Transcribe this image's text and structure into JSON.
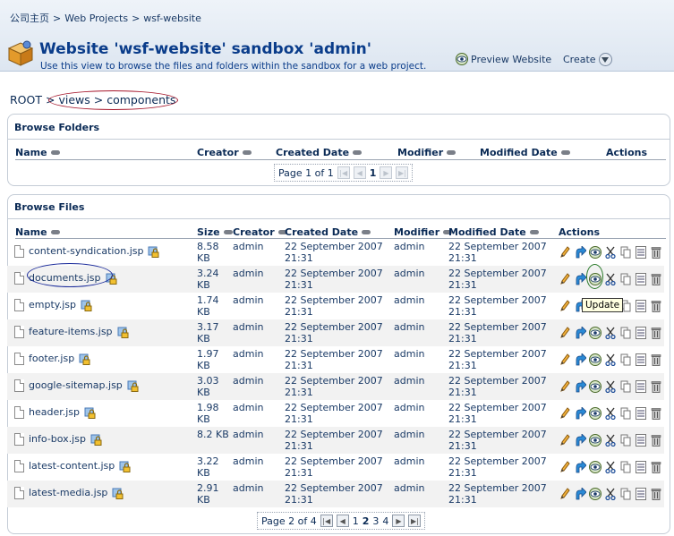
{
  "breadcrumbs": [
    "公司主页",
    "Web Projects",
    "wsf-website"
  ],
  "header": {
    "title": "Website 'wsf-website' sandbox 'admin'",
    "subtitle": "Use this view to browse the files and folders within the sandbox for a web project.",
    "preview_label": "Preview Website",
    "create_label": "Create"
  },
  "path": {
    "root": "ROOT",
    "sep": ">",
    "views": "views",
    "components": "components"
  },
  "folders": {
    "title": "Browse Folders",
    "columns": [
      "Name",
      "Creator",
      "Created Date",
      "Modifier",
      "Modified Date",
      "Actions"
    ],
    "pager": {
      "text": "Page 1 of 1",
      "current": "1"
    }
  },
  "files": {
    "title": "Browse Files",
    "columns": [
      "Name",
      "Size",
      "Creator",
      "Created Date",
      "Modifier",
      "Modified Date",
      "Actions"
    ],
    "rows": [
      {
        "name": "content-syndication.jsp",
        "size1": "8.58",
        "size2": "KB",
        "creator": "admin",
        "created1": "22 September 2007",
        "created2": "21:31",
        "modifier": "admin",
        "modified1": "22 September 2007",
        "modified2": "21:31"
      },
      {
        "name": "documents.jsp",
        "size1": "3.24",
        "size2": "KB",
        "creator": "admin",
        "created1": "22 September 2007",
        "created2": "21:31",
        "modifier": "admin",
        "modified1": "22 September 2007",
        "modified2": "21:31"
      },
      {
        "name": "empty.jsp",
        "size1": "1.74",
        "size2": "KB",
        "creator": "admin",
        "created1": "22 September 2007",
        "created2": "21:31",
        "modifier": "admin",
        "modified1": "22 September 2007",
        "modified2": "21:31"
      },
      {
        "name": "feature-items.jsp",
        "size1": "3.17",
        "size2": "KB",
        "creator": "admin",
        "created1": "22 September 2007",
        "created2": "21:31",
        "modifier": "admin",
        "modified1": "22 September 2007",
        "modified2": "21:31"
      },
      {
        "name": "footer.jsp",
        "size1": "1.97",
        "size2": "KB",
        "creator": "admin",
        "created1": "22 September 2007",
        "created2": "21:31",
        "modifier": "admin",
        "modified1": "22 September 2007",
        "modified2": "21:31"
      },
      {
        "name": "google-sitemap.jsp",
        "size1": "3.03",
        "size2": "KB",
        "creator": "admin",
        "created1": "22 September 2007",
        "created2": "21:31",
        "modifier": "admin",
        "modified1": "22 September 2007",
        "modified2": "21:31"
      },
      {
        "name": "header.jsp",
        "size1": "1.98",
        "size2": "KB",
        "creator": "admin",
        "created1": "22 September 2007",
        "created2": "21:31",
        "modifier": "admin",
        "modified1": "22 September 2007",
        "modified2": "21:31"
      },
      {
        "name": "info-box.jsp",
        "size1": "8.2 KB",
        "size2": "",
        "creator": "admin",
        "created1": "22 September 2007",
        "created2": "21:31",
        "modifier": "admin",
        "modified1": "22 September 2007",
        "modified2": "21:31"
      },
      {
        "name": "latest-content.jsp",
        "size1": "3.22",
        "size2": "KB",
        "creator": "admin",
        "created1": "22 September 2007",
        "created2": "21:31",
        "modifier": "admin",
        "modified1": "22 September 2007",
        "modified2": "21:31"
      },
      {
        "name": "latest-media.jsp",
        "size1": "2.91",
        "size2": "KB",
        "creator": "admin",
        "created1": "22 September 2007",
        "created2": "21:31",
        "modifier": "admin",
        "modified1": "22 September 2007",
        "modified2": "21:31"
      }
    ],
    "pager": {
      "text": "Page 2 of 4",
      "pages": [
        "1",
        "2",
        "3",
        "4"
      ],
      "current": "2"
    }
  },
  "tooltip": "Update",
  "icons": {
    "header": "sandbox-box-icon",
    "row_actions": [
      "edit-pencil-icon",
      "update-arrow-icon",
      "preview-eye-icon",
      "cut-scissors-icon",
      "copy-icon",
      "details-list-icon",
      "delete-trash-icon"
    ]
  },
  "colors": {
    "title_blue": "#0a3c8a",
    "header_bg": "#dde6f1",
    "row_shade": "#f2f2f2"
  }
}
